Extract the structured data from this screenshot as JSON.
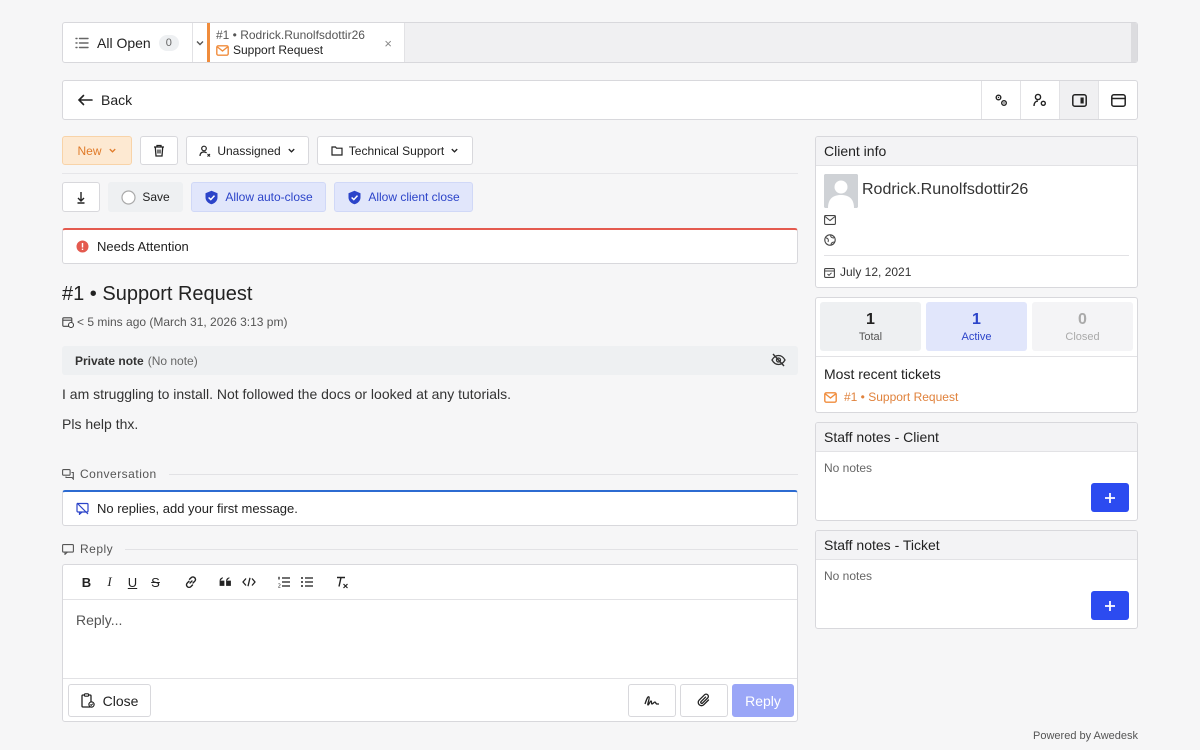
{
  "tabs": {
    "list_label": "All Open",
    "list_count": "0",
    "active_line1": "#1 • Rodrick.Runolfsdottir26",
    "active_line2": "Support Request",
    "close_glyph": "×"
  },
  "backbar": {
    "back_label": "Back",
    "icons": [
      "gears-icon",
      "user-gear-icon",
      "panel-right-icon",
      "window-icon"
    ]
  },
  "actions": {
    "status": "New",
    "assignee": "Unassigned",
    "department": "Technical Support",
    "save": "Save",
    "auto_close": "Allow auto-close",
    "client_close": "Allow client close"
  },
  "alert": {
    "text": "Needs Attention"
  },
  "ticket": {
    "title": "#1 • Support Request",
    "meta": "< 5 mins ago (March 31, 2026 3:13 pm)",
    "private_note_label": "Private note",
    "private_note_value": "(No note)",
    "body_line1": "I am struggling to install. Not followed the docs or looked at any tutorials.",
    "body_line2": "Pls help thx."
  },
  "conversation": {
    "heading": "Conversation",
    "empty": "No replies, add your first message."
  },
  "reply": {
    "heading": "Reply",
    "placeholder": "Reply...",
    "close_label": "Close",
    "reply_label": "Reply",
    "toolbar": [
      "B",
      "I",
      "U",
      "S"
    ]
  },
  "client": {
    "heading": "Client info",
    "name": "Rodrick.Runolfsdottir26",
    "date": "July 12, 2021"
  },
  "stats": {
    "total": {
      "value": "1",
      "label": "Total"
    },
    "active": {
      "value": "1",
      "label": "Active"
    },
    "closed": {
      "value": "0",
      "label": "Closed"
    },
    "recent_heading": "Most recent tickets",
    "recent_item": "#1 • Support Request"
  },
  "staff_client": {
    "heading": "Staff notes - Client",
    "empty": "No notes"
  },
  "staff_ticket": {
    "heading": "Staff notes - Ticket",
    "empty": "No notes"
  },
  "footer": {
    "powered": "Powered by Awedesk"
  },
  "colors": {
    "accent": "#2c4bf0",
    "warning": "#f08c3c",
    "danger": "#e45a4f",
    "info": "#2c6bd1"
  }
}
